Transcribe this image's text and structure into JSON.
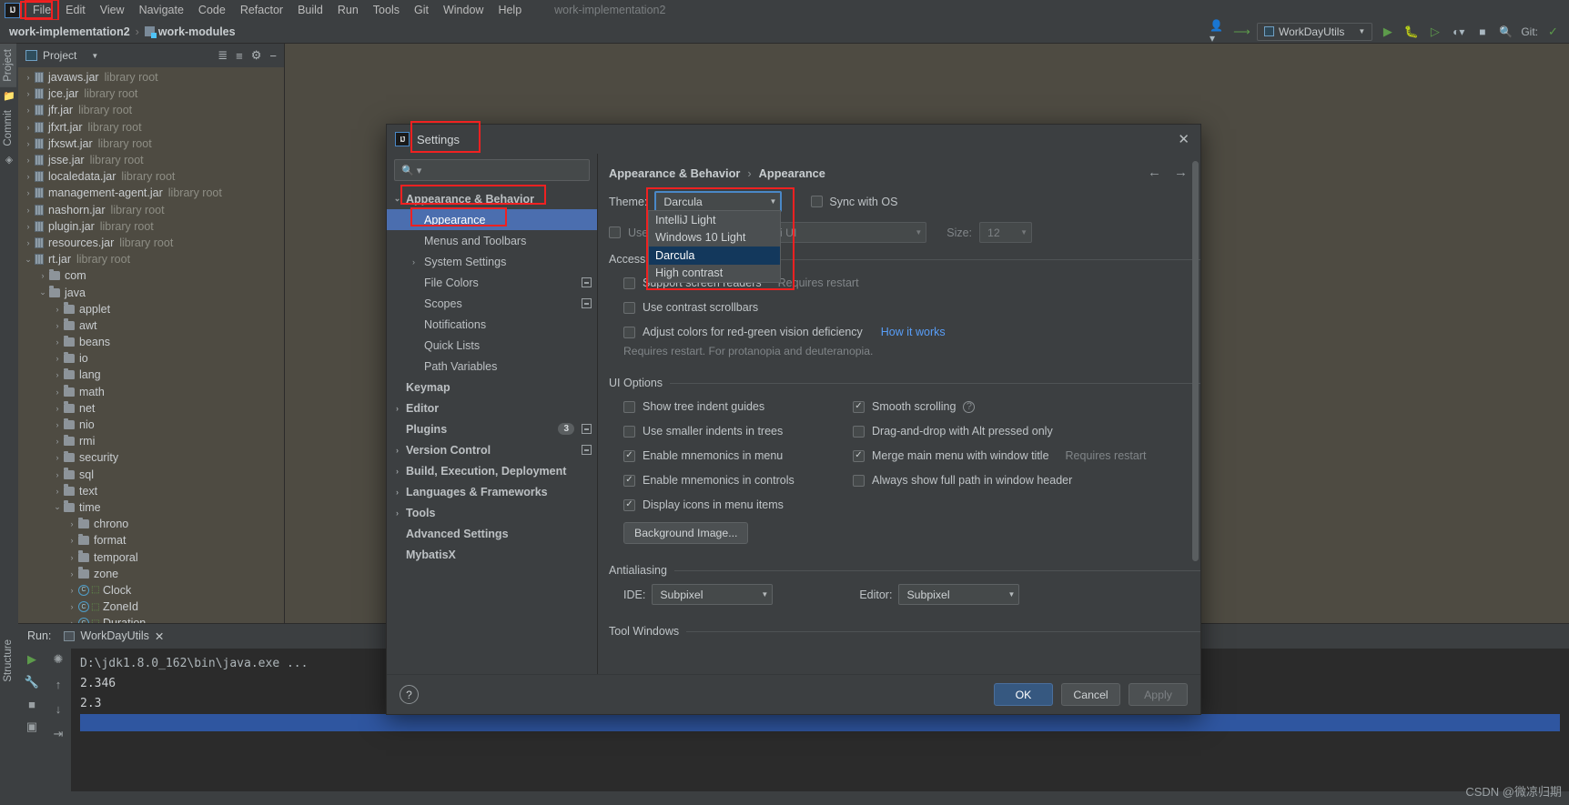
{
  "menubar": {
    "logo": "IJ",
    "items": [
      "File",
      "Edit",
      "View",
      "Navigate",
      "Code",
      "Refactor",
      "Build",
      "Run",
      "Tools",
      "Git",
      "Window",
      "Help"
    ],
    "window_title": "work-implementation2"
  },
  "navbar": {
    "crumb1": "work-implementation2",
    "separator": "›",
    "crumb2": "work-modules",
    "run_config": "WorkDayUtils",
    "git_label": "Git:"
  },
  "left_strip": {
    "project_tab": "Project",
    "commit_tab": "Commit",
    "structure_tab": "Structure"
  },
  "project_panel": {
    "title": "Project",
    "tree": [
      {
        "indent": 1,
        "arrow": "›",
        "icon": "jar-icon",
        "label": "javaws.jar",
        "sub": "library root"
      },
      {
        "indent": 1,
        "arrow": "›",
        "icon": "jar-icon",
        "label": "jce.jar",
        "sub": "library root"
      },
      {
        "indent": 1,
        "arrow": "›",
        "icon": "jar-icon",
        "label": "jfr.jar",
        "sub": "library root"
      },
      {
        "indent": 1,
        "arrow": "›",
        "icon": "jar-icon",
        "label": "jfxrt.jar",
        "sub": "library root"
      },
      {
        "indent": 1,
        "arrow": "›",
        "icon": "jar-icon",
        "label": "jfxswt.jar",
        "sub": "library root"
      },
      {
        "indent": 1,
        "arrow": "›",
        "icon": "jar-icon",
        "label": "jsse.jar",
        "sub": "library root"
      },
      {
        "indent": 1,
        "arrow": "›",
        "icon": "jar-icon",
        "label": "localedata.jar",
        "sub": "library root"
      },
      {
        "indent": 1,
        "arrow": "›",
        "icon": "jar-icon",
        "label": "management-agent.jar",
        "sub": "library root"
      },
      {
        "indent": 1,
        "arrow": "›",
        "icon": "jar-icon",
        "label": "nashorn.jar",
        "sub": "library root"
      },
      {
        "indent": 1,
        "arrow": "›",
        "icon": "jar-icon",
        "label": "plugin.jar",
        "sub": "library root"
      },
      {
        "indent": 1,
        "arrow": "›",
        "icon": "jar-icon",
        "label": "resources.jar",
        "sub": "library root"
      },
      {
        "indent": 1,
        "arrow": "⌄",
        "icon": "jar-icon",
        "label": "rt.jar",
        "sub": "library root"
      },
      {
        "indent": 2,
        "arrow": "›",
        "icon": "folder-icon",
        "label": "com",
        "sub": ""
      },
      {
        "indent": 2,
        "arrow": "⌄",
        "icon": "folder-icon",
        "label": "java",
        "sub": ""
      },
      {
        "indent": 3,
        "arrow": "›",
        "icon": "folder-icon",
        "label": "applet",
        "sub": ""
      },
      {
        "indent": 3,
        "arrow": "›",
        "icon": "folder-icon",
        "label": "awt",
        "sub": ""
      },
      {
        "indent": 3,
        "arrow": "›",
        "icon": "folder-icon",
        "label": "beans",
        "sub": ""
      },
      {
        "indent": 3,
        "arrow": "›",
        "icon": "folder-icon",
        "label": "io",
        "sub": ""
      },
      {
        "indent": 3,
        "arrow": "›",
        "icon": "folder-icon",
        "label": "lang",
        "sub": ""
      },
      {
        "indent": 3,
        "arrow": "›",
        "icon": "folder-icon",
        "label": "math",
        "sub": ""
      },
      {
        "indent": 3,
        "arrow": "›",
        "icon": "folder-icon",
        "label": "net",
        "sub": ""
      },
      {
        "indent": 3,
        "arrow": "›",
        "icon": "folder-icon",
        "label": "nio",
        "sub": ""
      },
      {
        "indent": 3,
        "arrow": "›",
        "icon": "folder-icon",
        "label": "rmi",
        "sub": ""
      },
      {
        "indent": 3,
        "arrow": "›",
        "icon": "folder-icon",
        "label": "security",
        "sub": ""
      },
      {
        "indent": 3,
        "arrow": "›",
        "icon": "folder-icon",
        "label": "sql",
        "sub": ""
      },
      {
        "indent": 3,
        "arrow": "›",
        "icon": "folder-icon",
        "label": "text",
        "sub": ""
      },
      {
        "indent": 3,
        "arrow": "⌄",
        "icon": "folder-icon",
        "label": "time",
        "sub": ""
      },
      {
        "indent": 4,
        "arrow": "›",
        "icon": "folder-icon",
        "label": "chrono",
        "sub": ""
      },
      {
        "indent": 4,
        "arrow": "›",
        "icon": "folder-icon",
        "label": "format",
        "sub": ""
      },
      {
        "indent": 4,
        "arrow": "›",
        "icon": "folder-icon",
        "label": "temporal",
        "sub": ""
      },
      {
        "indent": 4,
        "arrow": "›",
        "icon": "folder-icon",
        "label": "zone",
        "sub": ""
      },
      {
        "indent": 4,
        "arrow": "›",
        "icon": "class-icon",
        "label": "Clock",
        "sub": ""
      },
      {
        "indent": 4,
        "arrow": "›",
        "icon": "class-icon",
        "label": "ZoneId",
        "sub": ""
      },
      {
        "indent": 4,
        "arrow": "›",
        "icon": "class-icon",
        "label": "Duration",
        "sub": ""
      }
    ]
  },
  "run_panel": {
    "label": "Run:",
    "tab": "WorkDayUtils",
    "console_lines": [
      "D:\\jdk1.8.0_162\\bin\\java.exe ...",
      "2.346",
      "2.3"
    ]
  },
  "dialog": {
    "title": "Settings",
    "logo": "IJ",
    "close": "✕",
    "search_placeholder": "",
    "search_value": "",
    "nav": [
      {
        "label": "Appearance & Behavior",
        "level": 0,
        "bold": true,
        "arrow": "⌄",
        "selected": false
      },
      {
        "label": "Appearance",
        "level": 1,
        "bold": false,
        "arrow": "",
        "selected": true
      },
      {
        "label": "Menus and Toolbars",
        "level": 1,
        "bold": false,
        "arrow": "",
        "selected": false
      },
      {
        "label": "System Settings",
        "level": 1,
        "bold": false,
        "arrow": "›",
        "selected": false
      },
      {
        "label": "File Colors",
        "level": 1,
        "bold": false,
        "arrow": "",
        "selected": false,
        "badge": "plus"
      },
      {
        "label": "Scopes",
        "level": 1,
        "bold": false,
        "arrow": "",
        "selected": false,
        "badge": "plus"
      },
      {
        "label": "Notifications",
        "level": 1,
        "bold": false,
        "arrow": "",
        "selected": false
      },
      {
        "label": "Quick Lists",
        "level": 1,
        "bold": false,
        "arrow": "",
        "selected": false
      },
      {
        "label": "Path Variables",
        "level": 1,
        "bold": false,
        "arrow": "",
        "selected": false
      },
      {
        "label": "Keymap",
        "level": 0,
        "bold": true,
        "arrow": "",
        "selected": false
      },
      {
        "label": "Editor",
        "level": 0,
        "bold": true,
        "arrow": "›",
        "selected": false
      },
      {
        "label": "Plugins",
        "level": 0,
        "bold": true,
        "arrow": "",
        "selected": false,
        "count": "3",
        "badge": "plus"
      },
      {
        "label": "Version Control",
        "level": 0,
        "bold": true,
        "arrow": "›",
        "selected": false,
        "badge": "plus"
      },
      {
        "label": "Build, Execution, Deployment",
        "level": 0,
        "bold": true,
        "arrow": "›",
        "selected": false
      },
      {
        "label": "Languages & Frameworks",
        "level": 0,
        "bold": true,
        "arrow": "›",
        "selected": false
      },
      {
        "label": "Tools",
        "level": 0,
        "bold": true,
        "arrow": "›",
        "selected": false
      },
      {
        "label": "Advanced Settings",
        "level": 0,
        "bold": true,
        "arrow": "",
        "selected": false
      },
      {
        "label": "MybatisX",
        "level": 0,
        "bold": true,
        "arrow": "",
        "selected": false
      }
    ],
    "breadcrumb": {
      "part1": "Appearance & Behavior",
      "sep": "›",
      "part2": "Appearance"
    },
    "theme": {
      "label": "Theme:",
      "value": "Darcula",
      "sync_label": "Sync with OS",
      "sync_checked": false,
      "options": [
        "IntelliJ Light",
        "Windows 10 Light",
        "Darcula",
        "High contrast"
      ],
      "selected_option": "Darcula"
    },
    "font": {
      "use_label": "Use",
      "use_checked": false,
      "font_value": "Hei UI",
      "size_label": "Size:",
      "size_value": "12"
    },
    "accessibility": {
      "group": "Accessibility",
      "items": [
        {
          "label": "Support screen readers",
          "checked": false,
          "note": "Requires restart"
        },
        {
          "label": "Use contrast scrollbars",
          "checked": false,
          "note": ""
        },
        {
          "label": "Adjust colors for red-green vision deficiency",
          "checked": false,
          "link": "How it works"
        }
      ],
      "hint": "Requires restart. For protanopia and deuteranopia."
    },
    "ui_options": {
      "group": "UI Options",
      "left": [
        {
          "label": "Show tree indent guides",
          "checked": false
        },
        {
          "label": "Use smaller indents in trees",
          "checked": false
        },
        {
          "label": "Enable mnemonics in menu",
          "checked": true
        },
        {
          "label": "Enable mnemonics in controls",
          "checked": true
        },
        {
          "label": "Display icons in menu items",
          "checked": true
        }
      ],
      "right": [
        {
          "label": "Smooth scrolling",
          "checked": true,
          "help": true,
          "note": ""
        },
        {
          "label": "Drag-and-drop with Alt pressed only",
          "checked": false,
          "note": ""
        },
        {
          "label": "Merge main menu with window title",
          "checked": true,
          "note": "Requires restart"
        },
        {
          "label": "Always show full path in window header",
          "checked": false,
          "note": ""
        }
      ],
      "background_button": "Background Image..."
    },
    "antialiasing": {
      "group": "Antialiasing",
      "ide_label": "IDE:",
      "ide_value": "Subpixel",
      "editor_label": "Editor:",
      "editor_value": "Subpixel"
    },
    "tool_windows_group": "Tool Windows",
    "footer": {
      "help": "?",
      "ok": "OK",
      "cancel": "Cancel",
      "apply": "Apply"
    }
  },
  "watermark": "CSDN @微凉归期",
  "colors": {
    "accent": "#4b6eaf",
    "annotation_red": "#f02121",
    "link_blue": "#589df6",
    "dialog_bg": "#3c3f41",
    "tree_bg": "#4e4b42"
  }
}
